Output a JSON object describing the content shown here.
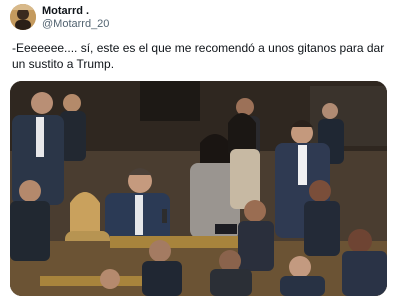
{
  "tweet": {
    "author": {
      "display_name": "Motarrd .",
      "handle": "@Motarrd_20",
      "avatar_icon": "profile-avatar"
    },
    "text": "-Eeeeeee.... sí, este es el que me recomendó a unos gitanos para dar un sustito a Trump.",
    "media": {
      "type": "video-still",
      "icon": "video-frame"
    }
  }
}
